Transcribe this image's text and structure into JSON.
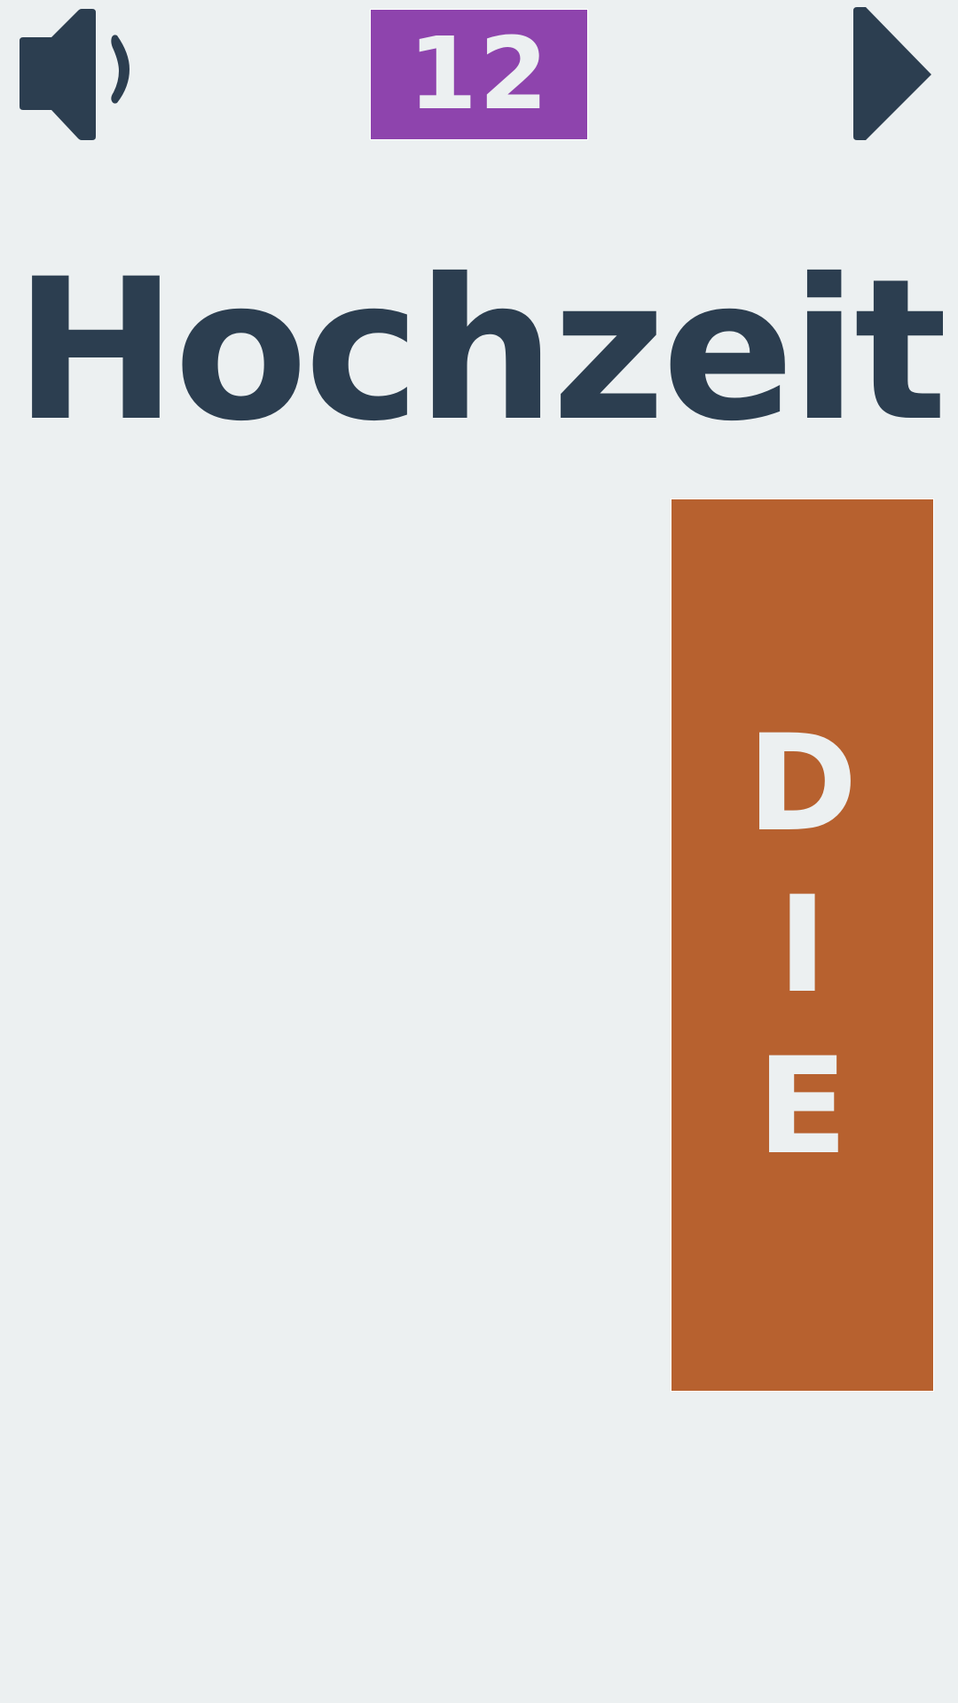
{
  "header": {
    "speaker_icon": "speaker-icon",
    "score": "12",
    "next_icon": "play-arrow-icon"
  },
  "word": {
    "text": "Hochzeit"
  },
  "article": {
    "letters": [
      "D",
      "I",
      "E"
    ]
  },
  "colors": {
    "background": "#ecf0f1",
    "text": "#2c3e50",
    "score_badge": "#8e44ad",
    "article_card": "#b7612f"
  }
}
